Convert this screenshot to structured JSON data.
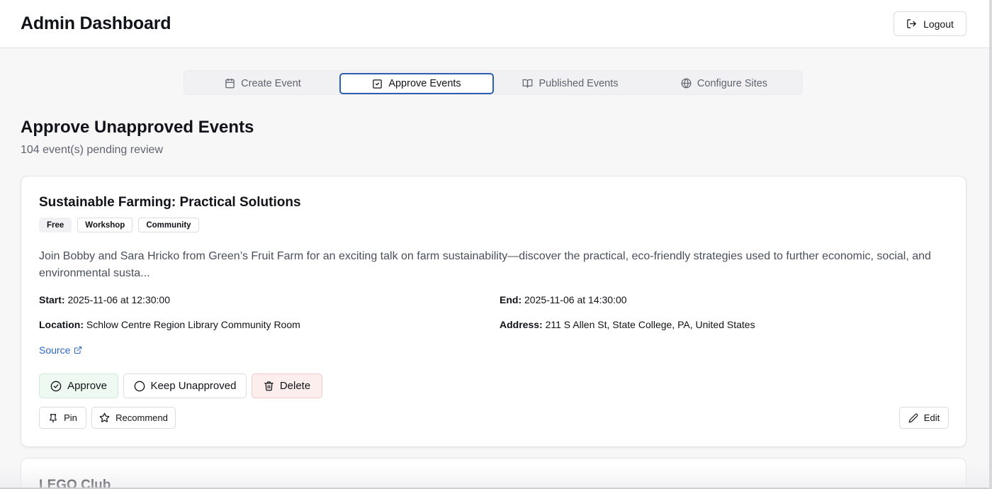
{
  "header": {
    "title": "Admin Dashboard",
    "logout_label": "Logout"
  },
  "tabs": [
    {
      "label": "Create Event",
      "icon": "calendar-icon",
      "active": false
    },
    {
      "label": "Approve Events",
      "icon": "check-square-icon",
      "active": true
    },
    {
      "label": "Published Events",
      "icon": "book-open-icon",
      "active": false
    },
    {
      "label": "Configure Sites",
      "icon": "globe-icon",
      "active": false
    }
  ],
  "main": {
    "title": "Approve Unapproved Events",
    "subtitle": "104 event(s) pending review"
  },
  "events": [
    {
      "title": "Sustainable Farming: Practical Solutions",
      "tags": [
        "Free",
        "Workshop",
        "Community"
      ],
      "description": "Join Bobby and Sara Hricko from Green’s Fruit Farm for an exciting talk on farm sustainability—discover the practical, eco-friendly strategies used to further economic, social, and environmental susta...",
      "start_label": "Start:",
      "start": "2025-11-06 at 12:30:00",
      "end_label": "End:",
      "end": "2025-11-06 at 14:30:00",
      "location_label": "Location:",
      "location": "Schlow Centre Region Library Community Room",
      "address_label": "Address:",
      "address": "211 S Allen St, State College, PA, United States",
      "source_label": "Source",
      "actions": {
        "approve": "Approve",
        "keep": "Keep Unapproved",
        "delete": "Delete",
        "pin": "Pin",
        "recommend": "Recommend",
        "edit": "Edit"
      }
    },
    {
      "title": "LEGO Club"
    }
  ],
  "colors": {
    "accent": "#2d5fb0",
    "link": "#2d66c4",
    "approve_bg": "#eefaf1",
    "delete_bg": "#fdeeee"
  }
}
